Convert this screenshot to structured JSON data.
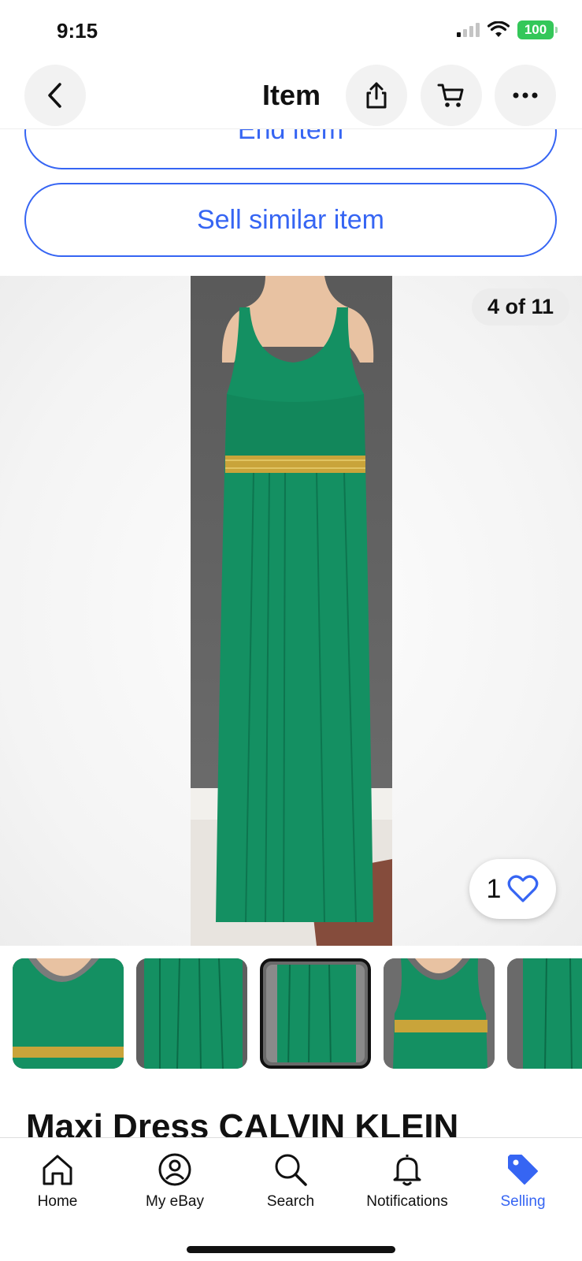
{
  "status": {
    "time": "9:15",
    "battery": "100"
  },
  "nav": {
    "title": "Item"
  },
  "actions": {
    "end_item": "End item",
    "sell_similar": "Sell similar item"
  },
  "gallery": {
    "counter": "4 of 11",
    "watch_count": "1"
  },
  "item": {
    "title": "Maxi Dress CALVIN KLEIN"
  },
  "tabs": [
    {
      "label": "Home",
      "icon": "home-icon"
    },
    {
      "label": "My eBay",
      "icon": "user-icon"
    },
    {
      "label": "Search",
      "icon": "search-icon"
    },
    {
      "label": "Notifications",
      "icon": "bell-icon"
    },
    {
      "label": "Selling",
      "icon": "tag-icon"
    }
  ],
  "colors": {
    "accent": "#3665f3",
    "dress": "#149062",
    "belt": "#c9a43a"
  }
}
